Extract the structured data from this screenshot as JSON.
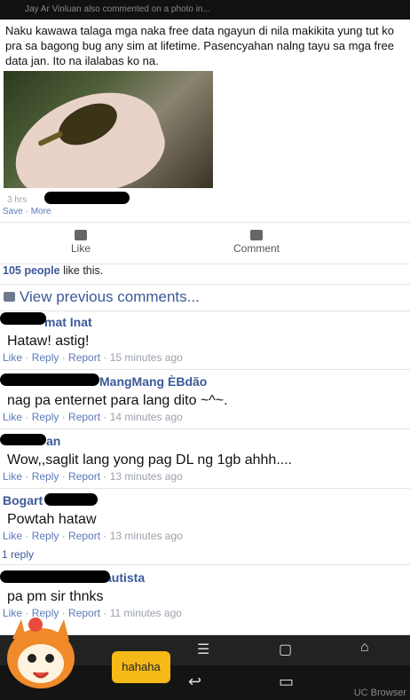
{
  "status_bar": {
    "notification": "Jay Ar Vinluan also commented on a photo in..."
  },
  "post": {
    "text": "Naku kawawa talaga mga naka free data ngayun di nila makikita yung tut ko pra sa bagong bug any sim at lifetime. Pasencyahan nalng tayu sa mga free data jan. Ito na ilalabas ko na.",
    "time": "3 hrs",
    "save_label": "Save",
    "more_label": "More"
  },
  "actions": {
    "like_label": "Like",
    "comment_label": "Comment"
  },
  "likes": {
    "count": "105 people",
    "suffix": "like this."
  },
  "view_previous_label": "View previous comments...",
  "comments": [
    {
      "author": "mat Inat",
      "text": "Hataw! astig!",
      "like": "Like",
      "reply": "Reply",
      "report": "Report",
      "time": "15 minutes ago"
    },
    {
      "author": "MangMang ÈBdão",
      "text": "nag pa enternet para lang dito ~^~.",
      "like": "Like",
      "reply": "Reply",
      "report": "Report",
      "time": "14 minutes ago"
    },
    {
      "author": "an",
      "text": "Wow,,saglit lang yong pag DL ng 1gb ahhh....",
      "like": "Like",
      "reply": "Reply",
      "report": "Report",
      "time": "13 minutes ago"
    },
    {
      "author": "Bogart omo",
      "text": "Powtah hataw",
      "like": "Like",
      "reply": "Reply",
      "report": "Report",
      "time": "13 minutes ago",
      "reply_count": "1 reply"
    },
    {
      "author": "autista",
      "text": "pa pm sir thnks",
      "like": "Like",
      "reply": "Reply",
      "report": "Report",
      "time": "11 minutes ago"
    }
  ],
  "overlay": {
    "bubble_text": "hahaha",
    "brand": "UC Browser"
  }
}
